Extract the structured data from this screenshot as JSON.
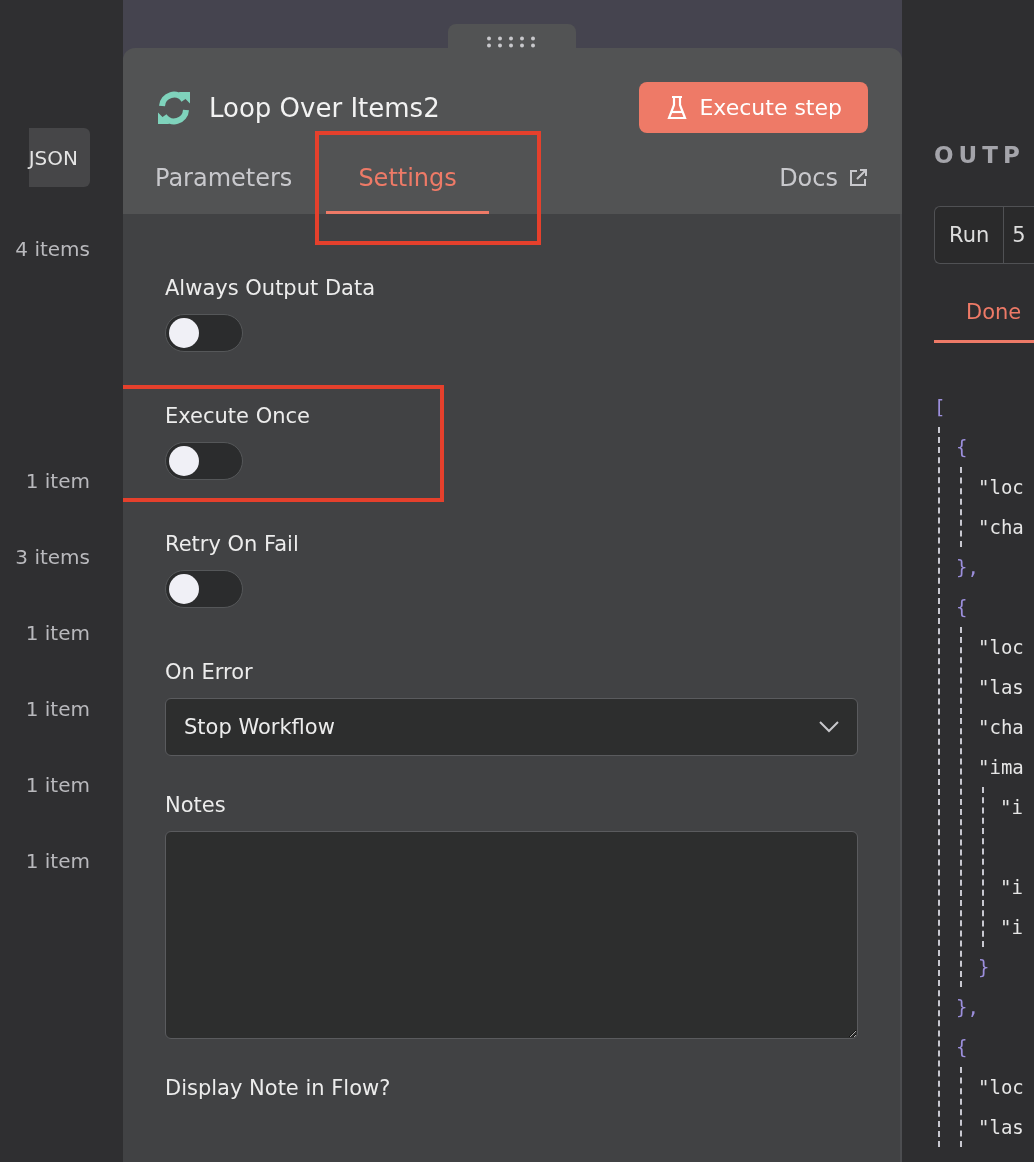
{
  "input_panel": {
    "view_button": "JSON",
    "item_counts": [
      "4 items",
      "1 item",
      "3 items",
      "1 item",
      "1 item",
      "1 item",
      "1 item"
    ]
  },
  "node_panel": {
    "title": "Loop Over Items2",
    "execute_button": "Execute step",
    "tabs": [
      {
        "label": "Parameters",
        "selected": false,
        "highlighted": false
      },
      {
        "label": "Settings",
        "selected": true,
        "highlighted": true
      }
    ],
    "docs_link": "Docs",
    "settings": [
      {
        "kind": "toggle",
        "label": "Always Output Data",
        "on": false,
        "highlighted": false
      },
      {
        "kind": "toggle",
        "label": "Execute Once",
        "on": false,
        "highlighted": true
      },
      {
        "kind": "toggle",
        "label": "Retry On Fail",
        "on": false,
        "highlighted": false
      },
      {
        "kind": "select",
        "label": "On Error",
        "value": "Stop Workflow",
        "highlighted": false
      },
      {
        "kind": "textarea",
        "label": "Notes",
        "highlighted": false
      },
      {
        "kind": "label",
        "label": "Display Note in Flow?",
        "highlighted": false
      }
    ]
  },
  "output_panel": {
    "heading": "OUTP",
    "run_selector": {
      "label": "Run",
      "value": "5"
    },
    "tabs": [
      {
        "label": "Done",
        "selected": true
      }
    ],
    "json_tree": [
      {
        "open": "[",
        "children": [
          {
            "open": "{",
            "close": "},",
            "children": [
              {
                "text": "\"loc"
              },
              {
                "text": "\"cha"
              }
            ]
          },
          {
            "open": "{",
            "close": "},",
            "children": [
              {
                "text": "\"loc"
              },
              {
                "text": "\"las"
              },
              {
                "text": "\"cha"
              },
              {
                "text": "\"ima",
                "close": "}",
                "children": [
                  {
                    "text": "\"i",
                    "wrapped": true
                  },
                  {
                    "text": "\"i"
                  },
                  {
                    "text": "\"i"
                  }
                ]
              }
            ]
          },
          {
            "open": "{",
            "children": [
              {
                "text": "\"loc"
              },
              {
                "text": "\"las"
              }
            ]
          }
        ]
      }
    ]
  }
}
